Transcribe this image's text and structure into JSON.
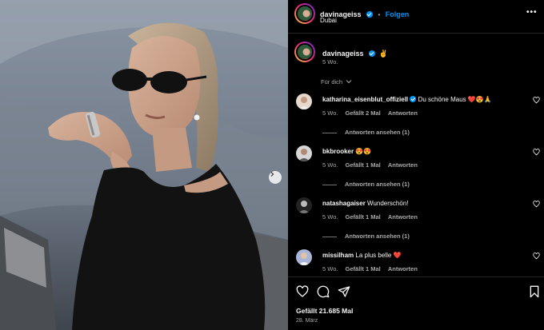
{
  "header": {
    "username": "davinageiss",
    "follow_label": "Folgen",
    "location": "Dubai",
    "more_label": "•••"
  },
  "caption": {
    "username": "davinageiss",
    "emoji": "✌️",
    "time": "5 Wo."
  },
  "translate_label": "Für dich",
  "comments": [
    {
      "username": "katharina_eisenblut_offiziell",
      "verified": true,
      "text": "Du schöne Maus ❤️😍🙏",
      "time": "5 Wo.",
      "likes": "Gefällt 2 Mal",
      "reply": "Antworten",
      "replies": "Antworten ansehen (1)"
    },
    {
      "username": "bkbrooker",
      "verified": false,
      "text": "😍😍",
      "time": "5 Wo.",
      "likes": "Gefällt 1 Mal",
      "reply": "Antworten",
      "replies": "Antworten ansehen (1)"
    },
    {
      "username": "natashagaiser",
      "verified": false,
      "text": "Wunderschön!",
      "time": "5 Wo.",
      "likes": "Gefällt 1 Mal",
      "reply": "Antworten",
      "replies": "Antworten ansehen (1)"
    },
    {
      "username": "missilham",
      "verified": false,
      "text": "La plus belle ❤️",
      "time": "5 Wo.",
      "likes": "Gefällt 1 Mal",
      "reply": "Antworten",
      "replies": ""
    }
  ],
  "footer": {
    "likes": "Gefällt 21.685 Mal",
    "date": "28. März"
  },
  "icons": {
    "like": "heart-icon",
    "comment": "comment-icon",
    "share": "paper-plane-icon",
    "save": "bookmark-icon",
    "carousel": "chevron-right-icon",
    "verified": "verified-badge-icon"
  },
  "colors": {
    "accent": "#0095f6",
    "background": "#000000",
    "secondary_text": "#a8a8a8"
  }
}
